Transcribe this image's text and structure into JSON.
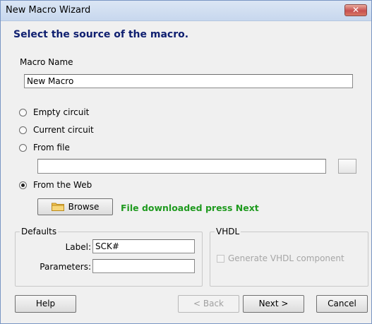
{
  "window": {
    "title": "New Macro Wizard",
    "close_label": "✕"
  },
  "heading": "Select the source of the macro.",
  "macro_name": {
    "label": "Macro Name",
    "value": "New Macro"
  },
  "source_options": [
    {
      "label": "Empty circuit",
      "checked": false
    },
    {
      "label": "Current circuit",
      "checked": false
    },
    {
      "label": "From file",
      "checked": false
    },
    {
      "label": "From the Web",
      "checked": true
    }
  ],
  "file_path": {
    "value": ""
  },
  "browse": {
    "label": "Browse",
    "icon": "folder-icon"
  },
  "status": {
    "text": "File downloaded press Next",
    "color": "#1f9a1f"
  },
  "defaults": {
    "title": "Defaults",
    "label_caption": "Label:",
    "label_value": "SCK#",
    "parameters_caption": "Parameters:",
    "parameters_value": ""
  },
  "vhdl": {
    "title": "VHDL",
    "generate_label": "Generate VHDL component",
    "generate_checked": false,
    "enabled": false
  },
  "buttons": {
    "help": "Help",
    "back": "< Back",
    "next": "Next >",
    "cancel": "Cancel"
  },
  "colors": {
    "heading": "#102070",
    "title_bar": "#c7d7ee",
    "close_button": "#c75050",
    "dialog_bg": "#f0f0f0"
  }
}
